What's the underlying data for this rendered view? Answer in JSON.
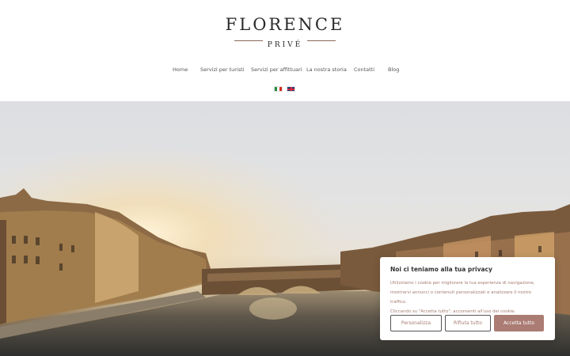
{
  "logo": {
    "title": "FLORENCE",
    "subtitle": "PRIVÉ"
  },
  "nav": {
    "items": [
      "Home",
      "Servizi per turisti",
      "Servizi per affittuari",
      "La nostra storia",
      "Contatti",
      "Blog"
    ]
  },
  "languages": [
    {
      "code": "it",
      "icon": "italy-flag-icon"
    },
    {
      "code": "en",
      "icon": "uk-flag-icon"
    }
  ],
  "hero": {
    "image": "ponte-vecchio-sunset"
  },
  "cookie": {
    "title": "Noi ci teniamo alla tua privacy",
    "text_lines": [
      "Utilizziamo i cookie per migliorare la tua esperienza di navigazione,",
      "mostrarvi annunci o contenuti personalizzati e analizzare il nostro traffico.",
      "Cliccando su \"Accetta tutto\", acconsenti all'uso dei cookie."
    ],
    "buttons": {
      "customize": "Personalizza",
      "reject": "Rifiuta tutto",
      "accept": "Accetta tutto"
    },
    "accent_color": "#ab7c73"
  }
}
